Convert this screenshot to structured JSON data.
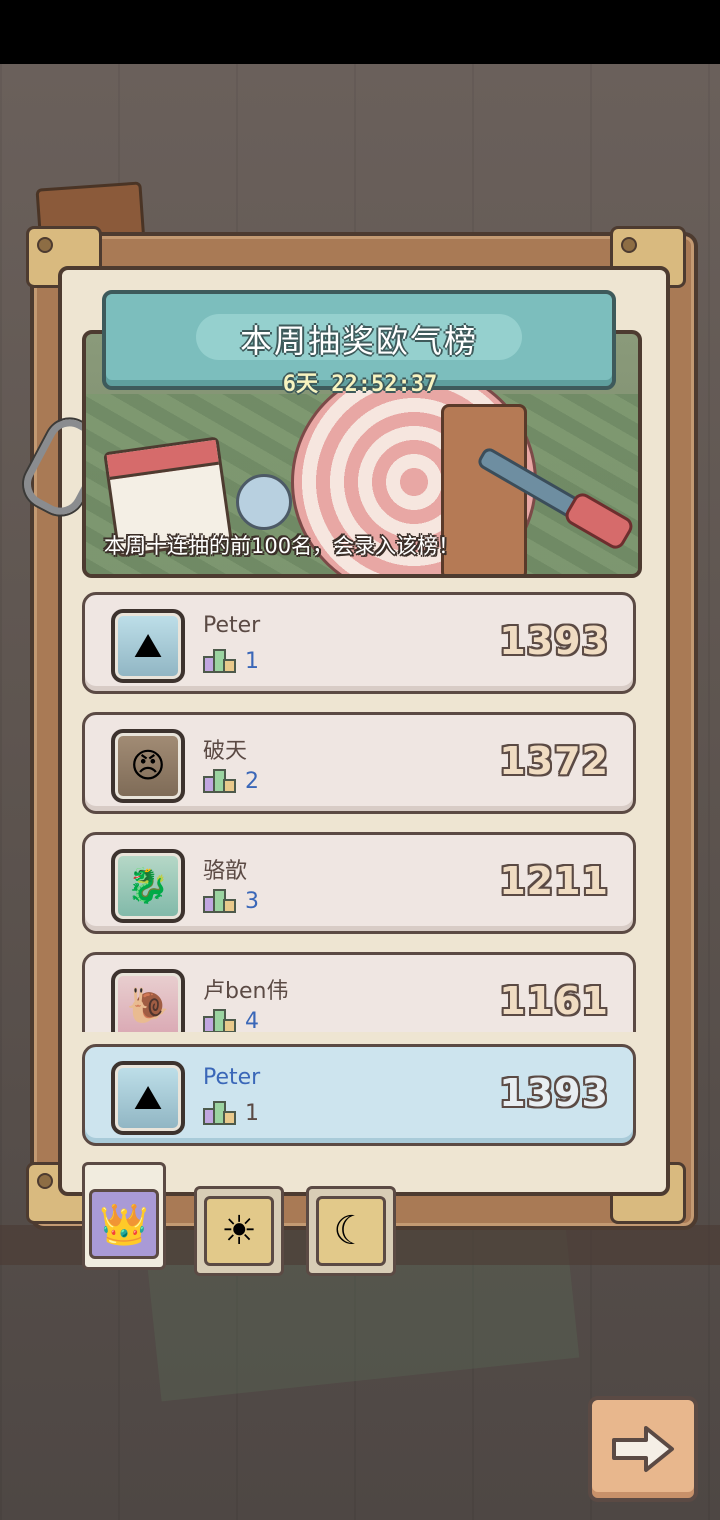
{
  "title": "本周抽奖欧气榜",
  "countdown": "6天 22:52:37",
  "banner_note": "本周十连抽的前100名，会录入该榜！",
  "leaderboard": [
    {
      "name": "Peter",
      "rank": "1",
      "score": "1393",
      "avatar": "ice-mountain-icon"
    },
    {
      "name": "破天",
      "rank": "2",
      "score": "1372",
      "avatar": "angry-face-icon"
    },
    {
      "name": "骆歆",
      "rank": "3",
      "score": "1211",
      "avatar": "dragon-icon"
    },
    {
      "name": "卢ben伟",
      "rank": "4",
      "score": "1161",
      "avatar": "snail-icon"
    }
  ],
  "self_entry": {
    "name": "Peter",
    "rank": "1",
    "score": "1393",
    "avatar": "ice-mountain-icon"
  },
  "tabs": [
    {
      "icon": "crown-icon",
      "active": true
    },
    {
      "icon": "sun-face-icon",
      "active": false
    },
    {
      "icon": "moon-face-icon",
      "active": false
    }
  ],
  "next_button_icon": "arrow-right-icon"
}
